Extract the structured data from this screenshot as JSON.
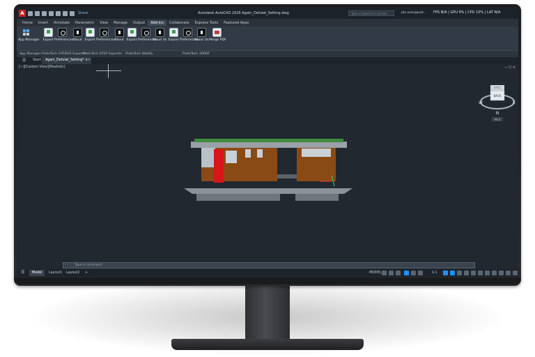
{
  "titlebar": {
    "app_logo": "A",
    "share": "Share",
    "title": "Autodesk AutoCAD 2026   Again_Defulat_Setting.dwg",
    "search_placeholder": "Type a keyword or phrase",
    "user": "pts.user@prot...",
    "perf": "FPS N/A  |  GPU 9%  |  CPU 10%  |  LAT N/A"
  },
  "menu": {
    "tabs": [
      "Home",
      "Insert",
      "Annotate",
      "Parametric",
      "View",
      "Manage",
      "Output",
      "Add-ins",
      "Collaborate",
      "Express Tools",
      "Featured Apps"
    ],
    "active_tab": "Add-ins"
  },
  "ribbon": {
    "buttons": [
      {
        "label": "App Manager",
        "icon": "app-manager"
      },
      {
        "label": "Export",
        "icon": "export"
      },
      {
        "label": "Preferences",
        "icon": "preferences"
      },
      {
        "label": "About",
        "icon": "about"
      },
      {
        "label": "Export",
        "icon": "export"
      },
      {
        "label": "Preferences",
        "icon": "preferences"
      },
      {
        "label": "About",
        "icon": "about"
      },
      {
        "label": "Export",
        "icon": "export"
      },
      {
        "label": "Preferences",
        "icon": "preferences"
      },
      {
        "label": "About Us",
        "icon": "about"
      },
      {
        "label": "Export",
        "icon": "export"
      },
      {
        "label": "Preferences",
        "icon": "preferences"
      },
      {
        "label": "About Us",
        "icon": "about"
      },
      {
        "label": "Merge PDF",
        "icon": "merge-pdf"
      }
    ],
    "panels": [
      "App Manager",
      "ProtoTech CATIAV5 Exporter",
      "ProtoTech STEP Exporter",
      "ProtoTech WebGL",
      "ProtoTech 3DPDF"
    ]
  },
  "filetabs": {
    "start": "Start",
    "active": "Again_Defulat_Setting*",
    "close": "×",
    "add": "+"
  },
  "viewport": {
    "label": "[−][Custom View][Realistic]",
    "controls": "− ☐ ×",
    "viewcube": {
      "face": "BACK",
      "top": "ATTIC",
      "compass_n": "N",
      "compass_w": "W",
      "compass_e": "E",
      "compass_s": "WCS"
    }
  },
  "commandline": {
    "placeholder": "Type a command"
  },
  "statusbar": {
    "layout_tabs": [
      "Model",
      "Layout1",
      "Layout2"
    ],
    "active_layout": "Model",
    "model_label": "MODEL",
    "scale": "1:1"
  },
  "colors": {
    "screen_bg": "#212830",
    "ribbon_bg": "#323b45",
    "accent": "#1e90ff",
    "brand_red": "#c42129"
  }
}
